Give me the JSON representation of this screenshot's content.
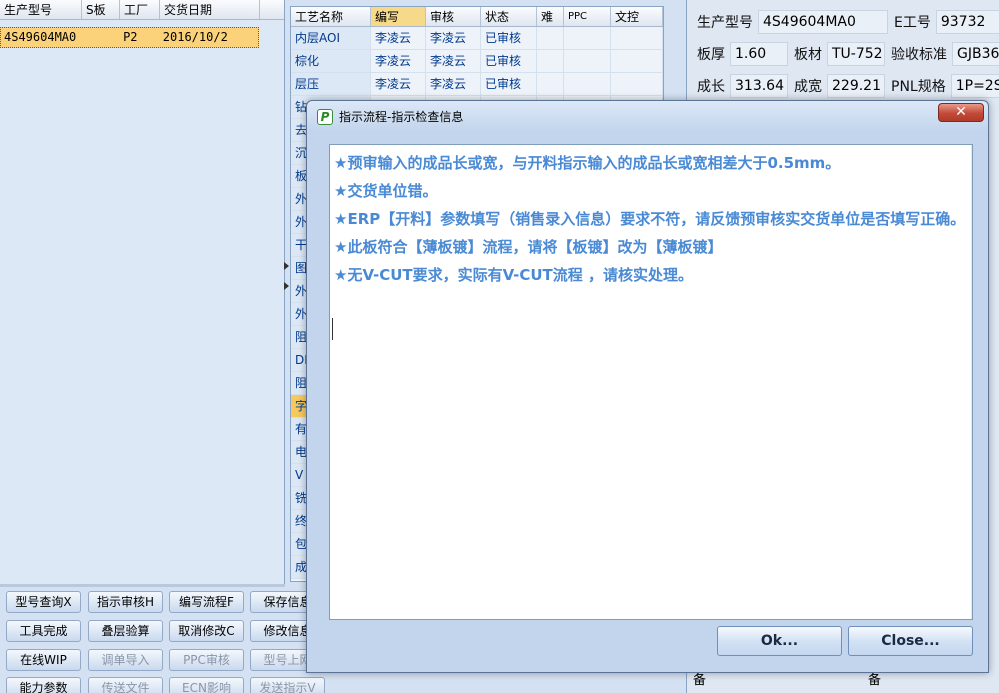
{
  "orders": {
    "headers": [
      "生产型号",
      "S板",
      "工厂",
      "交货日期"
    ],
    "rows": [
      {
        "model": "4S49604MA0",
        "sboard": "",
        "factory": "P2",
        "date": "2016/10/2"
      }
    ]
  },
  "process": {
    "headers": [
      "工艺名称",
      "编写",
      "审核",
      "状态",
      "难",
      "PPC",
      "文控"
    ],
    "rows": [
      {
        "name": "内层AOI",
        "writer": "李凌云",
        "reviewer": "李凌云",
        "status": "已审核"
      },
      {
        "name": "棕化",
        "writer": "李凌云",
        "reviewer": "李凌云",
        "status": "已审核"
      },
      {
        "name": "层压",
        "writer": "李凌云",
        "reviewer": "李凌云",
        "status": "已审核"
      },
      {
        "name": "钻",
        "writer": "",
        "reviewer": "",
        "status": ""
      },
      {
        "name": "去",
        "writer": "",
        "reviewer": "",
        "status": ""
      },
      {
        "name": "沉",
        "writer": "",
        "reviewer": "",
        "status": ""
      },
      {
        "name": "板",
        "writer": "",
        "reviewer": "",
        "status": ""
      },
      {
        "name": "外",
        "writer": "",
        "reviewer": "",
        "status": ""
      },
      {
        "name": "外",
        "writer": "",
        "reviewer": "",
        "status": ""
      },
      {
        "name": "干",
        "writer": "",
        "reviewer": "",
        "status": ""
      },
      {
        "name": "图",
        "writer": "",
        "reviewer": "",
        "status": ""
      },
      {
        "name": "外",
        "writer": "",
        "reviewer": "",
        "status": ""
      },
      {
        "name": "外",
        "writer": "",
        "reviewer": "",
        "status": ""
      },
      {
        "name": "阻",
        "writer": "",
        "reviewer": "",
        "status": ""
      },
      {
        "name": "DI",
        "writer": "",
        "reviewer": "",
        "status": ""
      },
      {
        "name": "阻",
        "writer": "",
        "reviewer": "",
        "status": ""
      },
      {
        "name": "字",
        "writer": "",
        "reviewer": "",
        "status": ""
      },
      {
        "name": "有",
        "writer": "",
        "reviewer": "",
        "status": ""
      },
      {
        "name": "电",
        "writer": "",
        "reviewer": "",
        "status": ""
      },
      {
        "name": "V",
        "writer": "",
        "reviewer": "",
        "status": ""
      },
      {
        "name": "铣",
        "writer": "",
        "reviewer": "",
        "status": ""
      },
      {
        "name": "终",
        "writer": "",
        "reviewer": "",
        "status": ""
      },
      {
        "name": "包",
        "writer": "",
        "reviewer": "",
        "status": ""
      },
      {
        "name": "成",
        "writer": "",
        "reviewer": "",
        "status": ""
      }
    ]
  },
  "info": {
    "model_label": "生产型号",
    "model_value": "4S49604MA0",
    "eng_label": "E工号",
    "eng_value": "93732",
    "thick_label": "板厚",
    "thick_value": "1.60",
    "material_label": "板材",
    "material_value": "TU-752",
    "std_label": "验收标准",
    "std_value": "GJB36",
    "len_label": "成长",
    "len_value": "313.64",
    "wid_label": "成宽",
    "wid_value": "229.21",
    "pnl_label": "PNL规格",
    "pnl_value": "1P=2S",
    "bottom_left": "备",
    "bottom_right": "备"
  },
  "toolbar": {
    "row1": [
      "型号查询X",
      "指示审核H",
      "编写流程F",
      "保存信息"
    ],
    "row2": [
      "工具完成",
      "叠层验算",
      "取消修改C",
      "修改信息"
    ],
    "row3": [
      "在线WIP",
      "调单导入",
      "PPC审核",
      "型号上网"
    ],
    "row4": [
      "能力参数",
      "传送文件",
      "ECN影响",
      "发送指示V"
    ]
  },
  "dialog": {
    "title": "指示流程-指示检查信息",
    "close_glyph": "✕",
    "messages": [
      "★预审输入的成品长或宽，与开料指示输入的成品长或宽相差大于0.5mm。",
      "★交货单位错。",
      "★ERP【开料】参数填写（销售录入信息）要求不符，请反馈预审核实交货单位是否填写正确。",
      "★此板符合【薄板镀】流程，请将【板镀】改为【薄板镀】",
      "★无V-CUT要求，实际有V-CUT流程 ，请核实处理。"
    ],
    "ok_label": "Ok...",
    "close_label": "Close..."
  },
  "colors": {
    "message_text": "#4a8ad4",
    "selected_row": "#fbd27a",
    "close_button": "#c24a38"
  }
}
